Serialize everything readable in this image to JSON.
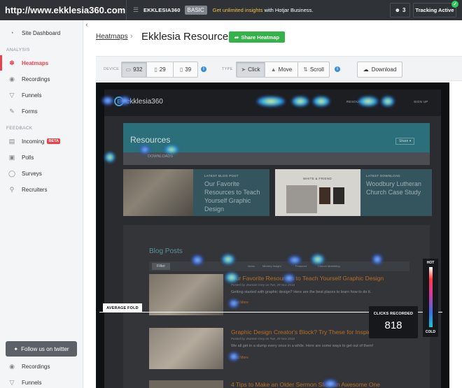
{
  "topbar": {
    "site_url": "http://www.ekklesia360.com",
    "site_name": "EKKLESIA360",
    "plan": "BASIC",
    "promo_highlight": "Get unlimited insights",
    "promo_rest": " with Hotjar Business.",
    "users_count": "3",
    "tracking_label": "Tracking Active"
  },
  "sidebar": {
    "dashboard": "Site Dashboard",
    "analysis_header": "ANALYSIS",
    "analysis_items": [
      {
        "label": "Heatmaps",
        "icon": "flame-icon"
      },
      {
        "label": "Recordings",
        "icon": "recording-icon"
      },
      {
        "label": "Funnels",
        "icon": "funnel-icon"
      },
      {
        "label": "Forms",
        "icon": "form-icon"
      }
    ],
    "feedback_header": "FEEDBACK",
    "incoming": "Incoming",
    "beta": "BETA",
    "feedback_items": [
      {
        "label": "Polls",
        "icon": "poll-icon"
      },
      {
        "label": "Surveys",
        "icon": "survey-icon"
      },
      {
        "label": "Recruiters",
        "icon": "recruiter-icon"
      }
    ],
    "twitter": "Follow us on twitter",
    "bottom_items": [
      {
        "label": "Recordings",
        "icon": "recording-icon"
      },
      {
        "label": "Funnels",
        "icon": "funnel-icon"
      }
    ]
  },
  "header": {
    "breadcrumb": "Heatmaps",
    "title": "Ekklesia Resources",
    "share_label": "Share Heatmap"
  },
  "toolbar": {
    "device_label": "DEVICE",
    "devices": [
      {
        "count": "932",
        "icon": "desktop-icon"
      },
      {
        "count": "29",
        "icon": "tablet-icon"
      },
      {
        "count": "39",
        "icon": "phone-icon"
      }
    ],
    "type_label": "TYPE",
    "types": [
      "Click",
      "Move",
      "Scroll"
    ],
    "download_label": "Download"
  },
  "heatmap_page": {
    "logo": "ekklesia360",
    "nav_links": [
      "RESOURCES",
      "SIGN UP"
    ],
    "resources_title": "Resources",
    "resources_button": "Share ▾",
    "resources_sub": "DOWNLOADS",
    "card1_tag": "LATEST BLOG POST",
    "card1_text": "Our Favorite Resources to Teach Yourself Graphic Design",
    "card2_tag": "WHITE & FRIEND",
    "card3_tag": "LATEST DOWNLOAD",
    "card3_text": "Woodbury Lutheran Church Case Study",
    "blog_title": "Blog Posts",
    "filter": "Filter",
    "filter_options": [
      "Ideas",
      "Ministry Insight",
      "Featured",
      "Church Marketing"
    ],
    "posts": [
      {
        "title": "Our Favorite Resources to Teach Yourself Graphic Design",
        "meta": "Posted by Jeannie Grey on Tue, 29 Nov 2016",
        "desc": "Getting started with graphic design? Here are the best places to learn how to do it.",
        "more": "Read More"
      },
      {
        "title": "Graphic Design Creator's Block? Try These for Inspiration",
        "meta": "Posted by Jeannie Grey on Tue, 29 Nov 2016",
        "desc": "We all get in a slump every once in a while. Here are some ways to get out of them!",
        "more": "Read More"
      },
      {
        "title": "4 Tips to Make an Older Sermon Slide an Awesome One",
        "meta": "",
        "desc": "",
        "more": ""
      }
    ]
  },
  "overlay": {
    "fold_label": "AVERAGE FOLD",
    "clicks_label": "CLICKS RECORDED",
    "clicks_value": "818",
    "legend_hot": "HOT",
    "legend_cold": "COLD"
  },
  "colors": {
    "accent": "#e8434c",
    "share_green": "#34b349",
    "topbar": "#2f3338",
    "promo_yellow": "#f6c343"
  }
}
